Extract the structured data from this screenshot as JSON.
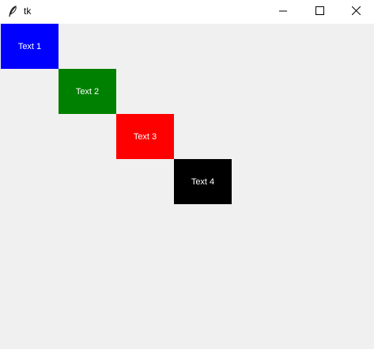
{
  "window": {
    "title": "tk",
    "icon": "feather-icon",
    "controls": {
      "minimize_icon": "minimize-icon",
      "maximize_icon": "maximize-icon",
      "close_icon": "close-icon"
    }
  },
  "labels": [
    {
      "text": "Text 1",
      "background": "#0000ff",
      "foreground": "#ffffff"
    },
    {
      "text": "Text 2",
      "background": "#008000",
      "foreground": "#ffffff"
    },
    {
      "text": "Text 3",
      "background": "#ff0000",
      "foreground": "#ffffff"
    },
    {
      "text": "Text 4",
      "background": "#000000",
      "foreground": "#ffffff"
    }
  ],
  "colors": {
    "window_bg": "#f0f0f0",
    "titlebar_bg": "#ffffff"
  }
}
